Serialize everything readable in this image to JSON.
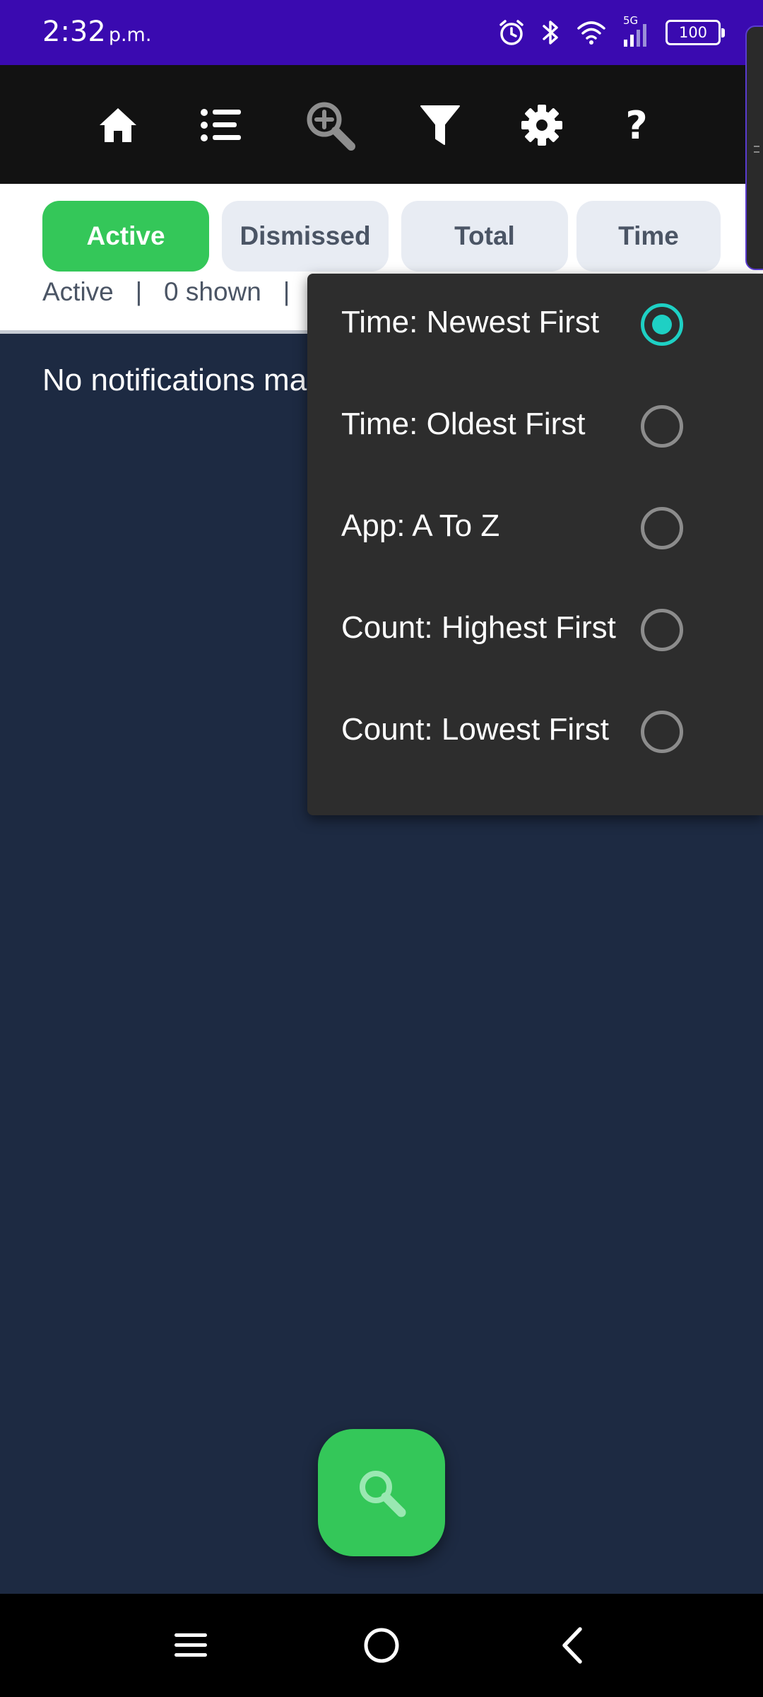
{
  "status_bar": {
    "time": "2:32",
    "ampm": "p.m.",
    "network_label": "5G",
    "battery": "100",
    "icons": [
      "alarm-icon",
      "bluetooth-icon",
      "wifi-icon",
      "signal-icon",
      "battery-icon"
    ],
    "background_color": "#3a0ab0"
  },
  "toolbar": {
    "icons": [
      "home-icon",
      "list-icon",
      "zoom-in-icon",
      "filter-icon",
      "gear-icon",
      "help-icon"
    ],
    "help_label": "?"
  },
  "tabs": [
    {
      "label": "Active",
      "selected": true
    },
    {
      "label": "Dismissed",
      "selected": false
    },
    {
      "label": "Total",
      "selected": false
    },
    {
      "label": "Time",
      "selected": false
    }
  ],
  "summary": {
    "text": "Active   |   0 shown   |"
  },
  "main": {
    "empty_message": "No notifications ma"
  },
  "sort_menu": {
    "options": [
      {
        "label": "Time: Newest First",
        "checked": true
      },
      {
        "label": "Time: Oldest First",
        "checked": false
      },
      {
        "label": "App: A To Z",
        "checked": false
      },
      {
        "label": "Count: Highest First",
        "checked": false
      },
      {
        "label": "Count: Lowest First",
        "checked": false
      }
    ]
  },
  "fab": {
    "icon": "search-icon"
  },
  "navbar": {
    "icons": [
      "recents-icon",
      "home-circle-icon",
      "back-icon"
    ]
  },
  "colors": {
    "accent_green": "#34c759",
    "radio_teal": "#1ed0c4",
    "main_background": "#1d2a42",
    "menu_background": "#2d2d2d"
  }
}
